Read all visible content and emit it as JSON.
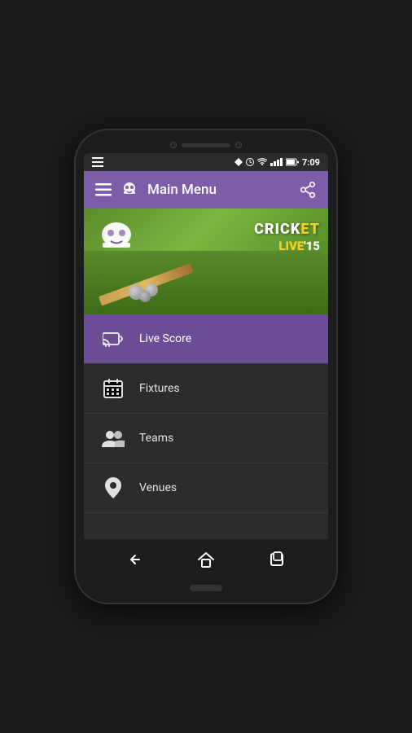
{
  "statusBar": {
    "time": "7:09",
    "icons": [
      "signal",
      "wifi",
      "battery"
    ]
  },
  "header": {
    "title": "Main Menu",
    "menu_icon": "hamburger-menu",
    "share_icon": "share-icon"
  },
  "banner": {
    "line1": "CRICK",
    "line1_highlight": "ET",
    "line2": "LIVE'15"
  },
  "menuItems": [
    {
      "id": "live-score",
      "label": "Live Score",
      "icon": "cast-icon",
      "active": true
    },
    {
      "id": "fixtures",
      "label": "Fixtures",
      "icon": "calendar-icon",
      "active": false
    },
    {
      "id": "teams",
      "label": "Teams",
      "icon": "teams-icon",
      "active": false
    },
    {
      "id": "venues",
      "label": "Venues",
      "icon": "location-icon",
      "active": false
    }
  ],
  "bottomNav": {
    "back": "←",
    "home": "⌂",
    "recents": "▣"
  },
  "colors": {
    "purple": "#7b5ea7",
    "dark_purple": "#6a4d94",
    "dark_bg": "#2c2c2c",
    "text_white": "#ffffff",
    "text_light": "#e0e0e0"
  }
}
